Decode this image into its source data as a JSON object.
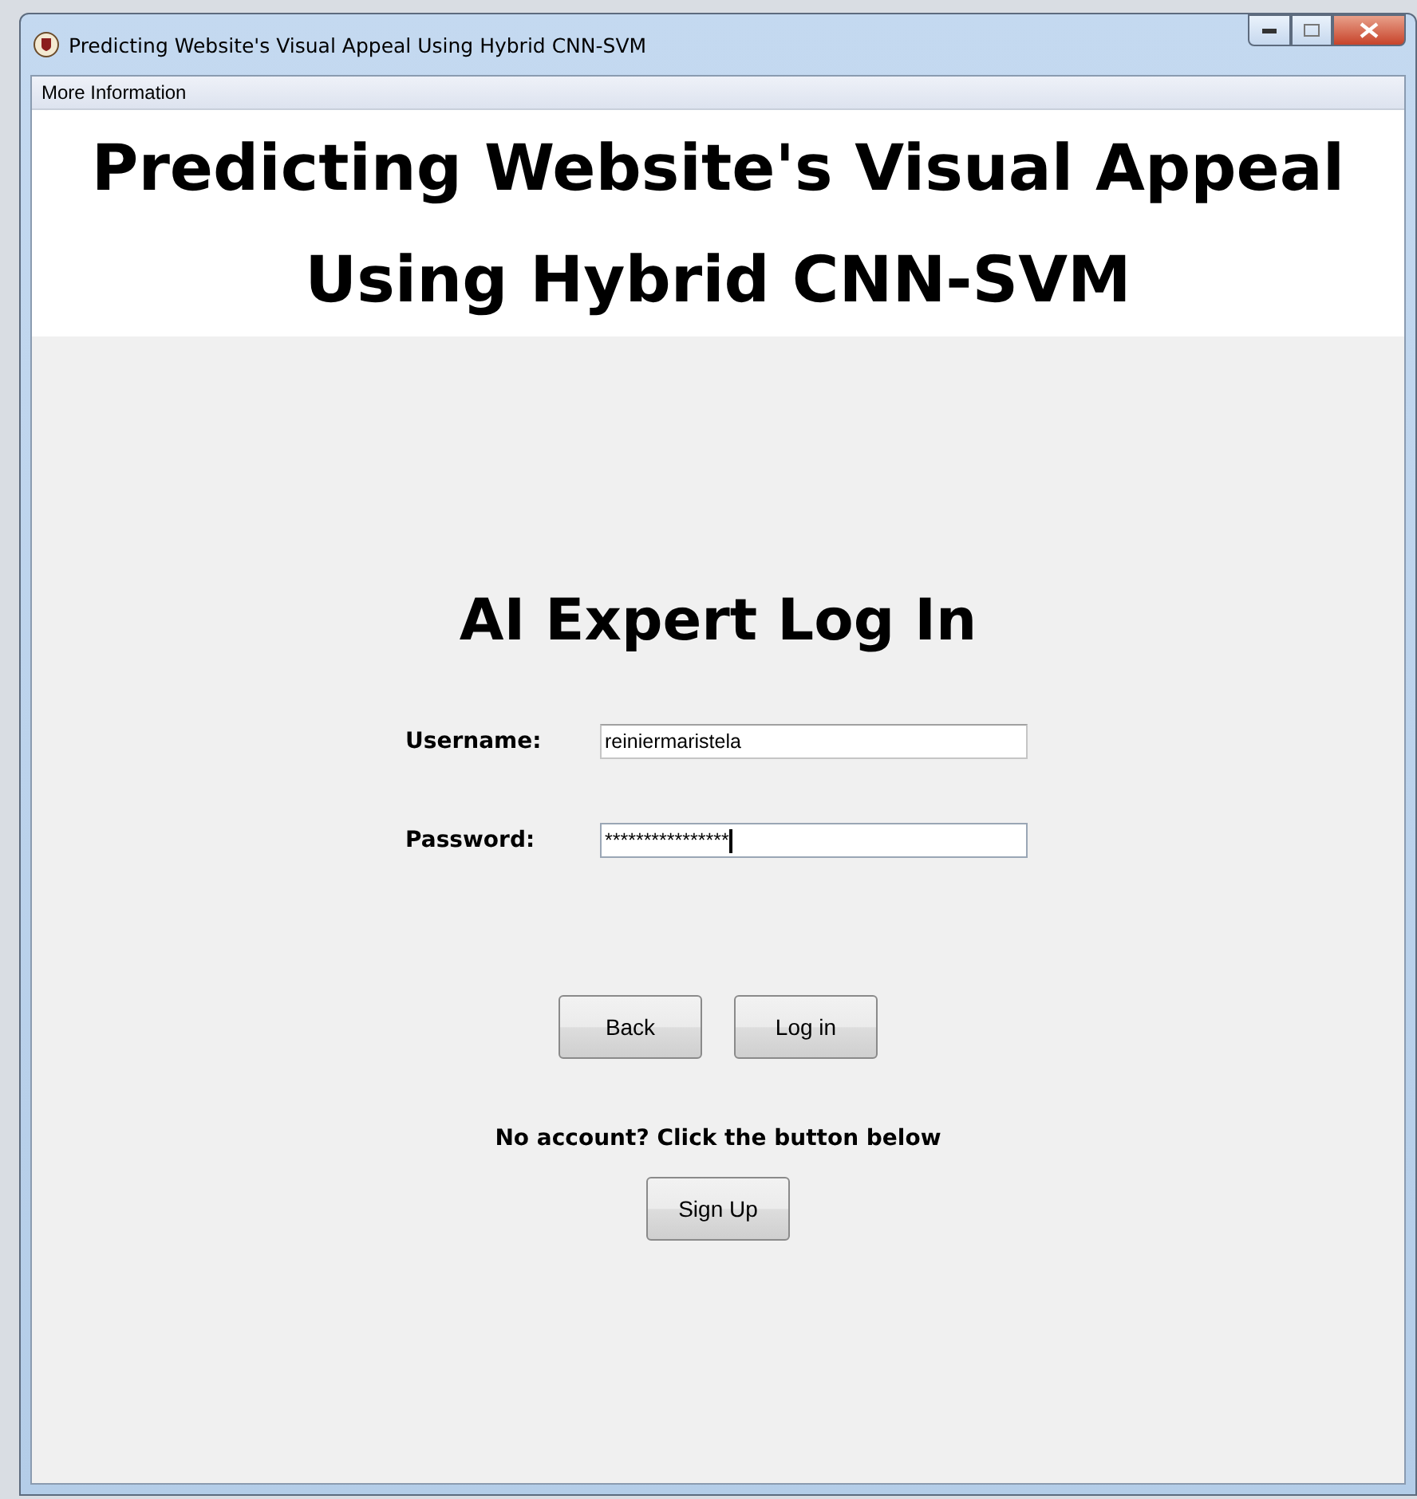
{
  "window": {
    "title": "Predicting Website's Visual Appeal Using Hybrid CNN-SVM"
  },
  "menu_bar": [
    "More Information"
  ],
  "header": {
    "title": "Predicting Website's Visual Appeal Using Hybrid CNN-SVM"
  },
  "login": {
    "heading": "AI Expert Log In",
    "fields": [
      {
        "label": "Username:",
        "value": "reiniermaristela",
        "focused": false
      },
      {
        "label": "Password:",
        "value": "****************",
        "focused": true
      }
    ],
    "buttons": [
      "Back",
      "Log in"
    ],
    "signup_prompt": "No account? Click the button below",
    "signup_button": "Sign Up"
  }
}
